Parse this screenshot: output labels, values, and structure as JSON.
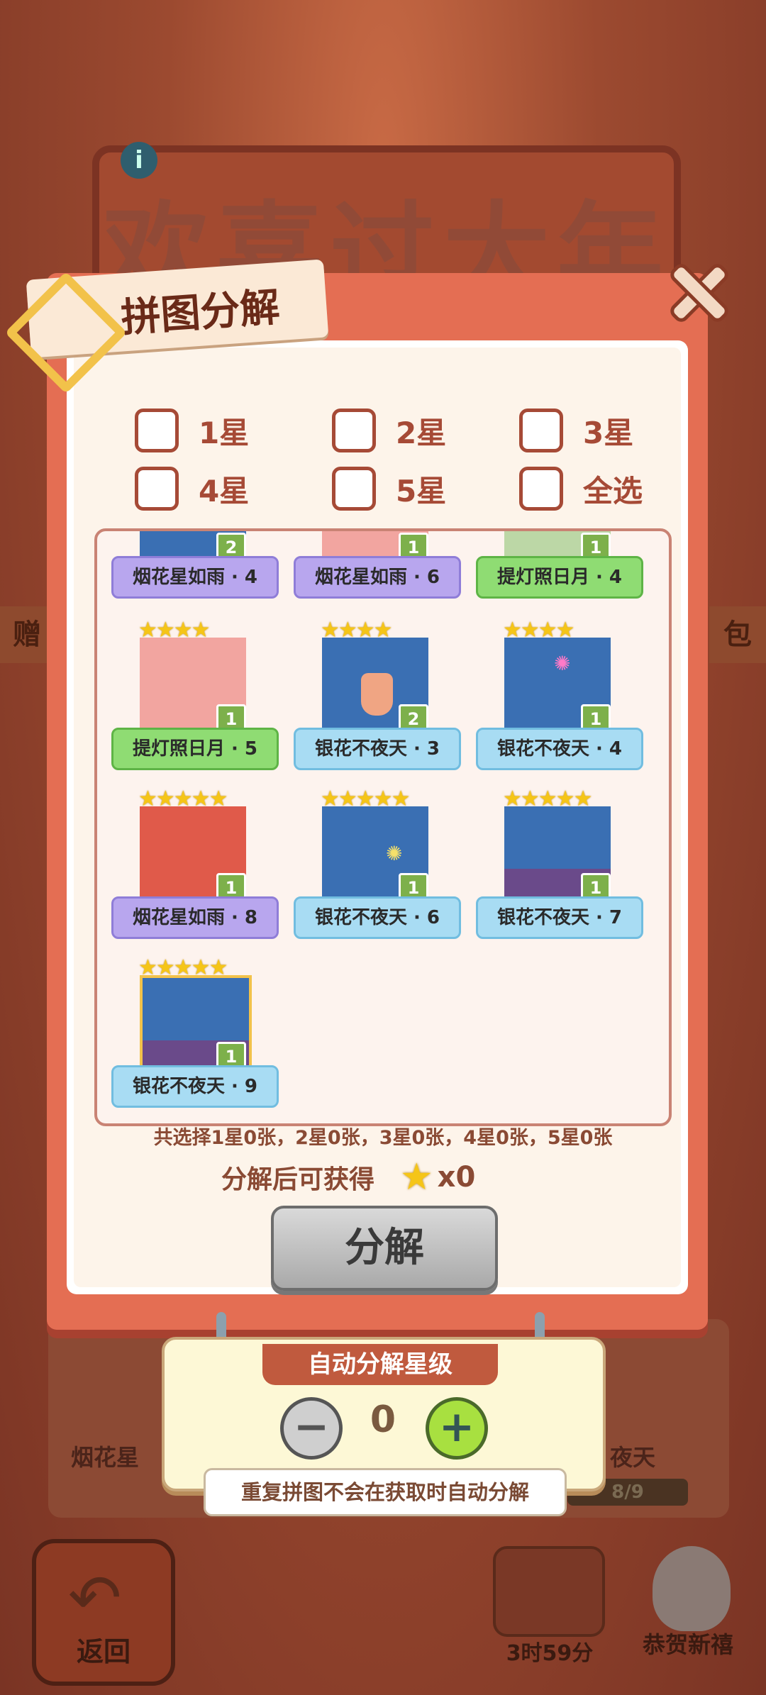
{
  "background": {
    "banner_title": "欢喜过大年",
    "info_icon": "i",
    "left_edge_text": "赠",
    "right_edge_text": "包",
    "bottom_left_title": "烟花星",
    "bottom_right_title": "夜天",
    "bottom_progress": "8/9",
    "back_label": "返回",
    "timer": "3时59分",
    "newyear_label": "恭贺新禧"
  },
  "modal": {
    "title": "拼图分解",
    "filters": [
      "1星",
      "2星",
      "3星",
      "4星",
      "5星",
      "全选"
    ],
    "cards": [
      {
        "name": "烟花星如雨 · 4",
        "count": "2",
        "ribbon": "purple",
        "stars": ""
      },
      {
        "name": "烟花星如雨 · 6",
        "count": "1",
        "ribbon": "purple",
        "stars": ""
      },
      {
        "name": "提灯照日月 · 4",
        "count": "1",
        "ribbon": "green",
        "stars": ""
      },
      {
        "name": "提灯照日月 · 5",
        "count": "1",
        "ribbon": "green",
        "stars": "★★★★"
      },
      {
        "name": "银花不夜天 · 3",
        "count": "2",
        "ribbon": "blue",
        "stars": "★★★★"
      },
      {
        "name": "银花不夜天 · 4",
        "count": "1",
        "ribbon": "blue",
        "stars": "★★★★"
      },
      {
        "name": "烟花星如雨 · 8",
        "count": "1",
        "ribbon": "purple",
        "stars": "★★★★★"
      },
      {
        "name": "银花不夜天 · 6",
        "count": "1",
        "ribbon": "blue",
        "stars": "★★★★★"
      },
      {
        "name": "银花不夜天 · 7",
        "count": "1",
        "ribbon": "blue",
        "stars": "★★★★★"
      },
      {
        "name": "银花不夜天 · 9",
        "count": "1",
        "ribbon": "blue",
        "stars": "★★★★★"
      }
    ],
    "summary": "共选择1星0张，2星0张，3星0张，4星0张，5星0张",
    "yield_label": "分解后可获得",
    "yield_count": "x0",
    "decompose_button": "分解"
  },
  "auto": {
    "title": "自动分解星级",
    "value": "0",
    "minus": "−",
    "plus": "+",
    "note": "重复拼图不会在获取时自动分解"
  }
}
